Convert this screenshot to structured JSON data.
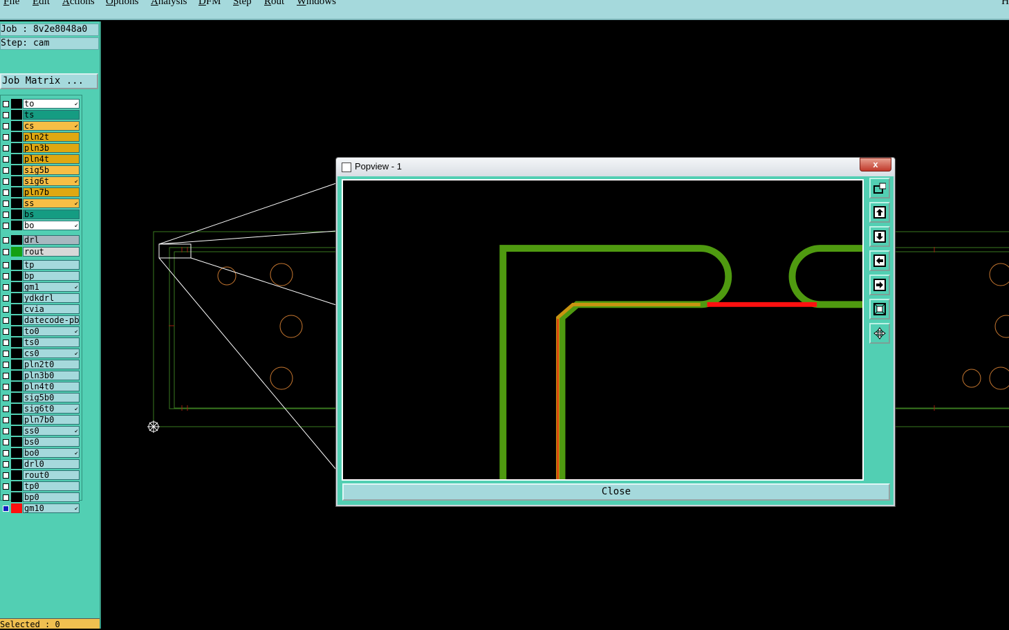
{
  "menu": {
    "items": [
      "File",
      "Edit",
      "Actions",
      "Options",
      "Analysis",
      "DFM",
      "Step",
      "Rout",
      "Windows"
    ],
    "right_label": "H"
  },
  "panel": {
    "job": "Job : 8v2e8048a0",
    "step": "Step: cam",
    "job_matrix": "Job Matrix ...",
    "selected": "Selected : 0"
  },
  "layers": [
    {
      "name": "to",
      "bg": "#ffffff",
      "arrow": true,
      "group": 0
    },
    {
      "name": "ts",
      "bg": "#159c82",
      "arrow": false,
      "group": 0
    },
    {
      "name": "cs",
      "bg": "#f7be45",
      "arrow": true,
      "group": 0
    },
    {
      "name": "pln2t",
      "bg": "#dfa812",
      "arrow": false,
      "group": 0
    },
    {
      "name": "pln3b",
      "bg": "#dfa812",
      "arrow": false,
      "group": 0
    },
    {
      "name": "pln4t",
      "bg": "#dfa812",
      "arrow": false,
      "group": 0
    },
    {
      "name": "sig5b",
      "bg": "#f7be45",
      "arrow": false,
      "group": 0
    },
    {
      "name": "sig6t",
      "bg": "#f7be45",
      "arrow": true,
      "group": 0
    },
    {
      "name": "pln7b",
      "bg": "#dfa812",
      "arrow": false,
      "group": 0
    },
    {
      "name": "ss",
      "bg": "#f7be45",
      "arrow": true,
      "group": 0
    },
    {
      "name": "bs",
      "bg": "#159c82",
      "arrow": false,
      "group": 0
    },
    {
      "name": "bo",
      "bg": "#ffffff",
      "arrow": true,
      "group": 0
    },
    {
      "name": "drl",
      "bg": "#a8b8c0",
      "arrow": false,
      "group": 1
    },
    {
      "name": "rout",
      "bg": "#d8d8d8",
      "arrow": false,
      "group": 1,
      "color": "#14a012"
    },
    {
      "name": "tp",
      "bg": "#a5d9dc",
      "arrow": false,
      "group": 2
    },
    {
      "name": "bp",
      "bg": "#a5d9dc",
      "arrow": false,
      "group": 2
    },
    {
      "name": "gm1",
      "bg": "#a5d9dc",
      "arrow": true,
      "group": 2
    },
    {
      "name": "ydkdrl",
      "bg": "#a5d9dc",
      "arrow": false,
      "group": 2
    },
    {
      "name": "cvia",
      "bg": "#a5d9dc",
      "arrow": false,
      "group": 2
    },
    {
      "name": "datecode-pbc",
      "bg": "#a5d9dc",
      "arrow": false,
      "group": 2
    },
    {
      "name": "to0",
      "bg": "#a5d9dc",
      "arrow": true,
      "group": 2
    },
    {
      "name": "ts0",
      "bg": "#a5d9dc",
      "arrow": false,
      "group": 2
    },
    {
      "name": "cs0",
      "bg": "#a5d9dc",
      "arrow": true,
      "group": 2
    },
    {
      "name": "pln2t0",
      "bg": "#a5d9dc",
      "arrow": false,
      "group": 2
    },
    {
      "name": "pln3b0",
      "bg": "#a5d9dc",
      "arrow": false,
      "group": 2
    },
    {
      "name": "pln4t0",
      "bg": "#a5d9dc",
      "arrow": false,
      "group": 2
    },
    {
      "name": "sig5b0",
      "bg": "#a5d9dc",
      "arrow": false,
      "group": 2
    },
    {
      "name": "sig6t0",
      "bg": "#a5d9dc",
      "arrow": true,
      "group": 2
    },
    {
      "name": "pln7b0",
      "bg": "#a5d9dc",
      "arrow": false,
      "group": 2
    },
    {
      "name": "ss0",
      "bg": "#a5d9dc",
      "arrow": true,
      "group": 2
    },
    {
      "name": "bs0",
      "bg": "#a5d9dc",
      "arrow": false,
      "group": 2
    },
    {
      "name": "bo0",
      "bg": "#a5d9dc",
      "arrow": true,
      "group": 2
    },
    {
      "name": "drl0",
      "bg": "#a5d9dc",
      "arrow": false,
      "group": 2
    },
    {
      "name": "rout0",
      "bg": "#a5d9dc",
      "arrow": false,
      "group": 2
    },
    {
      "name": "tp0",
      "bg": "#a5d9dc",
      "arrow": false,
      "group": 2
    },
    {
      "name": "bp0",
      "bg": "#a5d9dc",
      "arrow": false,
      "group": 2
    },
    {
      "name": "gm10",
      "bg": "#a5d9dc",
      "arrow": true,
      "group": 2,
      "color": "#ff1010",
      "selected": true
    }
  ],
  "popview": {
    "title": "Popview - 1",
    "close_x": "x",
    "close_button": "Close",
    "tools": [
      "popout-icon",
      "zoom-top-icon",
      "zoom-bottom-icon",
      "zoom-left-icon",
      "zoom-right-icon",
      "fit-all-icon",
      "pan-icon"
    ]
  },
  "colors": {
    "trace_green": "#4f9a10",
    "trace_red": "#ff1010",
    "trace_orange": "#c89410",
    "outline": "#3a7a20",
    "pad": "#c87830"
  }
}
